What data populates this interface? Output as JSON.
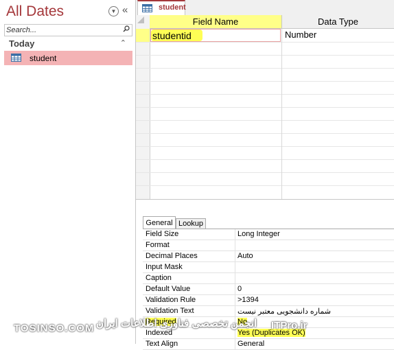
{
  "nav": {
    "title": "All Dates",
    "search_placeholder": "Search...",
    "group_label": "Today",
    "items": [
      {
        "label": "student"
      }
    ]
  },
  "tabs": [
    {
      "label": "student"
    }
  ],
  "grid": {
    "col_field_name": "Field Name",
    "col_data_type": "Data Type",
    "rows": [
      {
        "field_name": "studentid",
        "data_type": "Number"
      }
    ]
  },
  "properties": {
    "tab_general": "General",
    "tab_lookup": "Lookup",
    "rows": [
      {
        "name": "Field Size",
        "value": "Long Integer"
      },
      {
        "name": "Format",
        "value": ""
      },
      {
        "name": "Decimal Places",
        "value": "Auto"
      },
      {
        "name": "Input Mask",
        "value": ""
      },
      {
        "name": "Caption",
        "value": ""
      },
      {
        "name": "Default Value",
        "value": "0"
      },
      {
        "name": "Validation Rule",
        "value": ">1394"
      },
      {
        "name": "Validation Text",
        "value": "شماره دانشجویی معتبر نیست"
      },
      {
        "name": "Required",
        "value": "No"
      },
      {
        "name": "Indexed",
        "value": "Yes (Duplicates OK)"
      },
      {
        "name": "Text Align",
        "value": "General"
      }
    ]
  },
  "watermark": {
    "left": "TOSINSO.COM",
    "right": "انجمن تخصصی فناوری اطلاعات ایران",
    "brand": "ITPro.ir"
  },
  "colors": {
    "accent": "#a4373a",
    "highlight": "#ffff55",
    "selection": "#f4b3b5"
  }
}
